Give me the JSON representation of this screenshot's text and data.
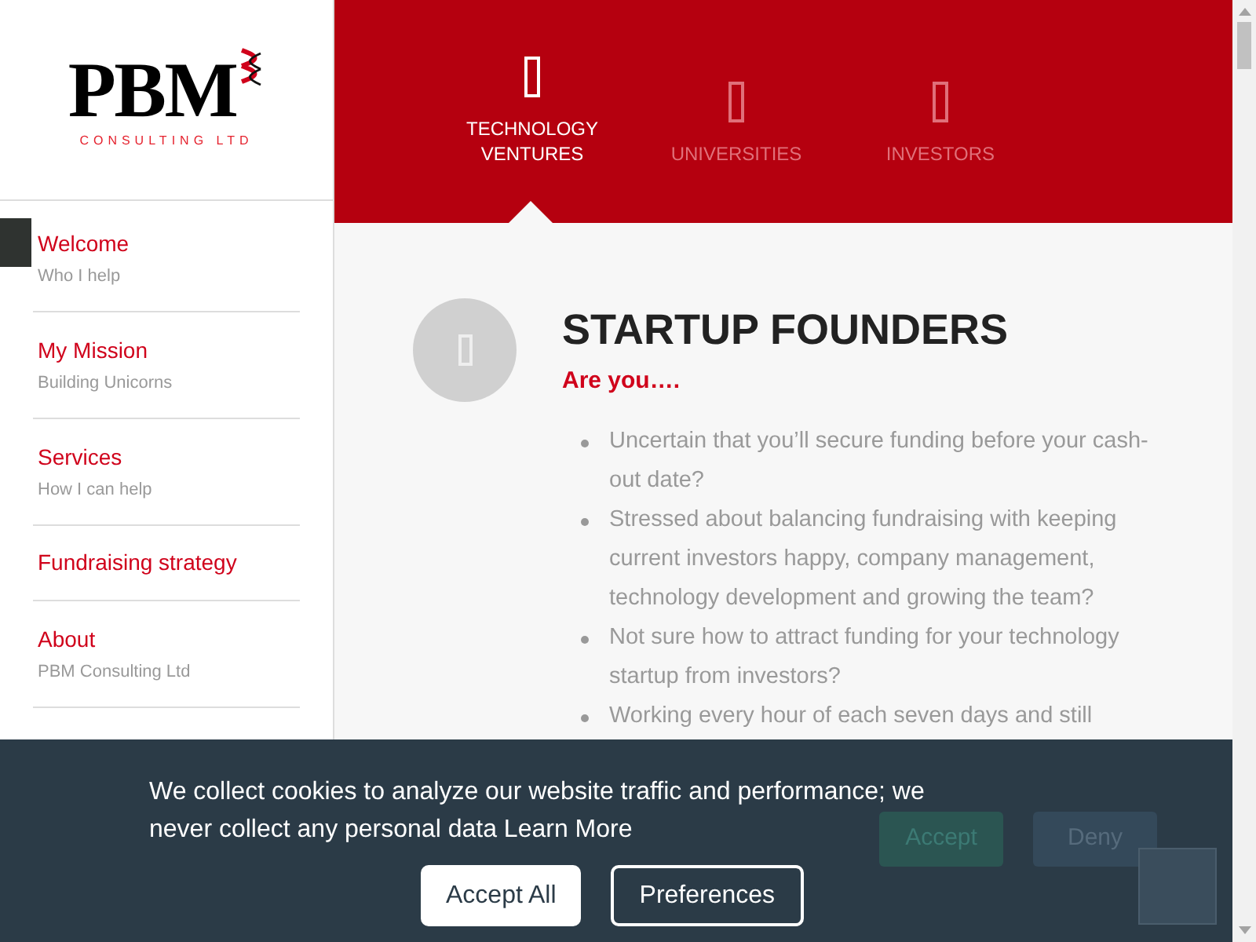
{
  "logo": {
    "wordmark": "PBM",
    "tagline": "CONSULTING LTD"
  },
  "sidebar": {
    "items": [
      {
        "title": "Welcome",
        "subtitle": "Who I help"
      },
      {
        "title": "My Mission",
        "subtitle": "Building Unicorns"
      },
      {
        "title": "Services",
        "subtitle": "How I can help"
      },
      {
        "title": "Fundraising strategy"
      },
      {
        "title": "About",
        "subtitle": "PBM Consulting Ltd"
      }
    ]
  },
  "tabs": [
    {
      "label": "TECHNOLOGY VENTURES",
      "selected": true
    },
    {
      "label": "UNIVERSITIES",
      "selected": false
    },
    {
      "label": "INVESTORS",
      "selected": false
    }
  ],
  "section": {
    "title": "STARTUP FOUNDERS",
    "lead": "Are you….",
    "bullets": [
      "Uncertain that you’ll secure funding before your cash-out date?",
      "Stressed about balancing fundraising with keeping current investors happy, company management, technology development and growing the team?",
      "Not sure how to attract funding for your technology startup from investors?",
      "Working every hour of each seven days and still"
    ]
  },
  "cookie_banner": {
    "message": "We collect cookies to analyze our website traffic and performance; we never collect any personal data",
    "link": "Learn More",
    "buttons": [
      "Accept All",
      "Preferences"
    ],
    "faded_buttons": [
      "Accept",
      "Deny"
    ]
  }
}
